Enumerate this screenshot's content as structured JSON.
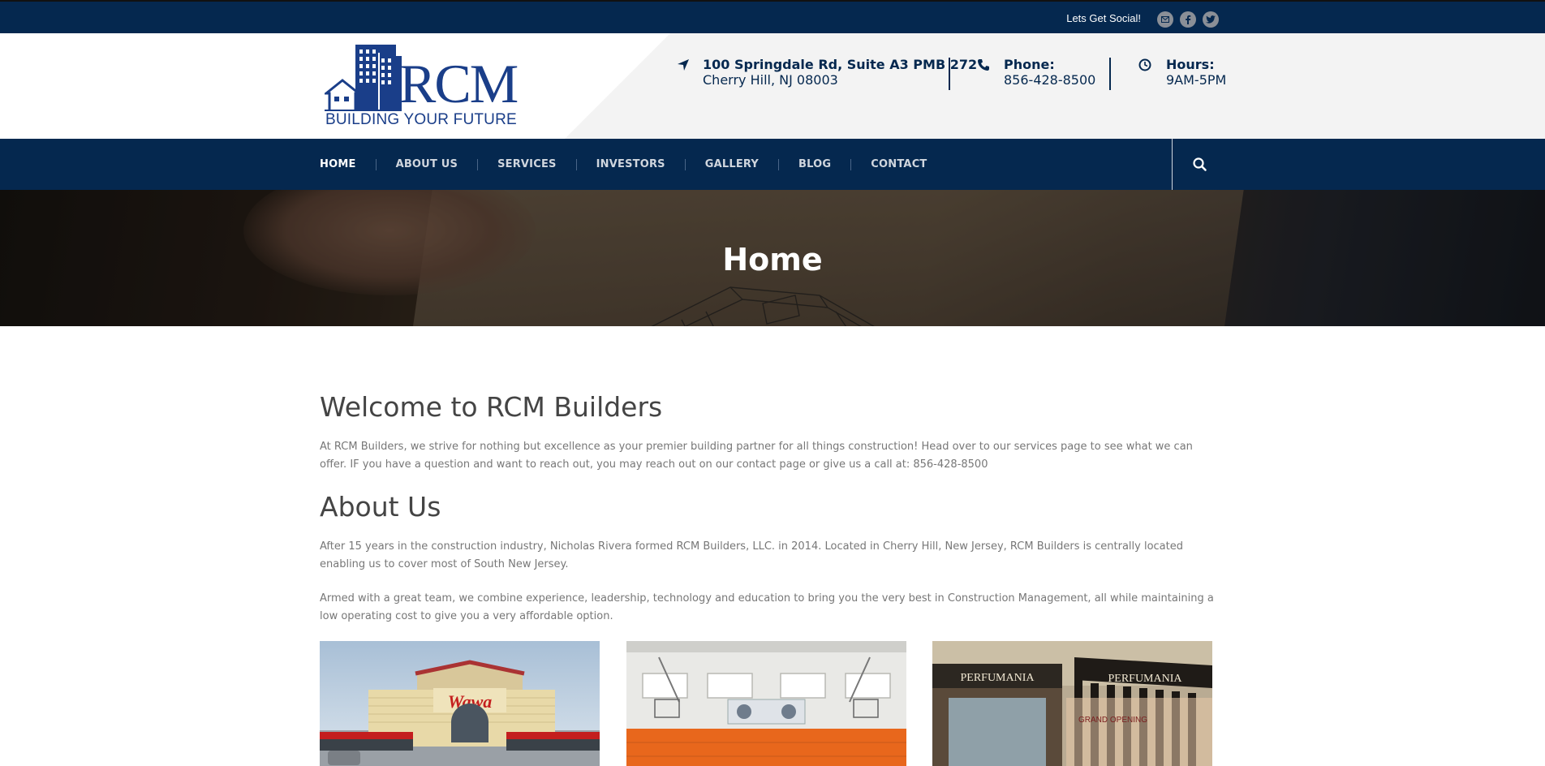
{
  "topbar": {
    "social_label": "Lets Get Social!",
    "icons": [
      "email-icon",
      "facebook-icon",
      "twitter-icon"
    ]
  },
  "header": {
    "logo_text": "RCM",
    "logo_tagline": "BUILDING YOUR FUTURE",
    "address": {
      "line1": "100 Springdale Rd, Suite A3 PMB 272",
      "line2": "Cherry Hill, NJ 08003"
    },
    "phone": {
      "label": "Phone:",
      "value": "856-428-8500"
    },
    "hours": {
      "label": "Hours:",
      "value": "9AM-5PM"
    }
  },
  "nav": {
    "items": [
      "HOME",
      "ABOUT US",
      "SERVICES",
      "INVESTORS",
      "GALLERY",
      "BLOG",
      "CONTACT"
    ],
    "active": "HOME"
  },
  "hero": {
    "title": "Home"
  },
  "content": {
    "welcome_heading": "Welcome to RCM Builders",
    "welcome_text": "At RCM Builders, we strive for nothing but excellence as your premier building partner for all things construction! Head over to our services page to see what we can offer. IF you have a question and want to reach out, you may reach out on our contact page or give us a call at: 856-428-8500",
    "about_heading": "About Us",
    "about_p1": "After 15 years in the construction industry, Nicholas Rivera formed RCM Builders, LLC. in 2014. Located in Cherry Hill, New Jersey, RCM Builders is centrally located enabling us to cover most of South New Jersey.",
    "about_p2": "Armed with a great team, we combine experience, leadership, technology and education to bring you the very best in Construction Management, all while maintaining a low operating cost to give you a very affordable option."
  },
  "gallery": {
    "signs": {
      "wawa": "Wawa",
      "perfumania": "PERFUMANIA",
      "grand_opening": "GRAND OPENING"
    }
  },
  "colors": {
    "navy": "#05284f",
    "logo_blue": "#1a3e89",
    "text_gray": "#777777",
    "heading_gray": "#444444"
  }
}
